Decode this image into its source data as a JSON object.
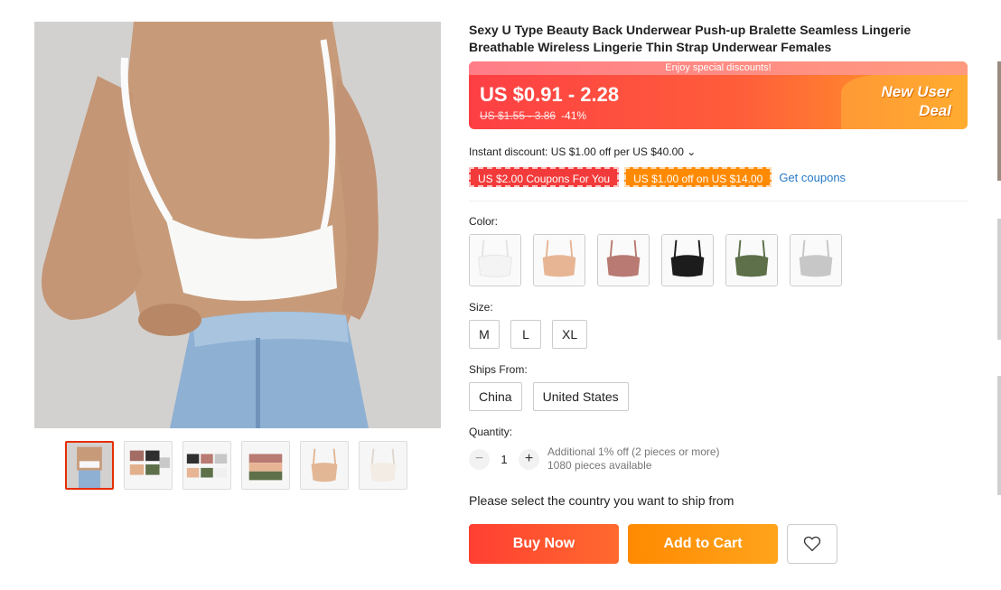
{
  "product": {
    "title": "Sexy U Type Beauty Back Underwear Push-up Bralette Seamless Lingerie Breathable Wireless Lingerie Thin Strap Underwear Females",
    "main_image_alt": "product-photo-back-view"
  },
  "gallery": {
    "thumbnails": [
      {
        "name": "thumb-1",
        "tone": "#c9b8a8"
      },
      {
        "name": "thumb-2",
        "tone": "#8a8278"
      },
      {
        "name": "thumb-3",
        "tone": "#6d6a66"
      },
      {
        "name": "thumb-4",
        "tone": "#b9a189"
      },
      {
        "name": "thumb-5",
        "tone": "#e2b796"
      },
      {
        "name": "thumb-6",
        "tone": "#efe8e0"
      }
    ]
  },
  "price": {
    "banner": "Enjoy special discounts!",
    "current": "US $0.91 - 2.28",
    "original": "US $1.55 - 3.86",
    "discount": "-41%",
    "deal_line1": "New User",
    "deal_line2": "Deal"
  },
  "instant_discount": "Instant discount: US $1.00 off per US $40.00 ⌄",
  "coupons": {
    "coupon1": "US $2.00 Coupons For You",
    "coupon2": "US $1.00 off on US $14.00",
    "get": "Get coupons"
  },
  "color": {
    "label": "Color:",
    "swatches": [
      {
        "name": "white",
        "fill": "#f4f4f4"
      },
      {
        "name": "beige",
        "fill": "#e8b594"
      },
      {
        "name": "rose",
        "fill": "#b87a72"
      },
      {
        "name": "black",
        "fill": "#1c1c1c"
      },
      {
        "name": "green",
        "fill": "#5d7049"
      },
      {
        "name": "gray",
        "fill": "#c7c7c7"
      }
    ]
  },
  "size": {
    "label": "Size:",
    "options": [
      "M",
      "L",
      "XL"
    ]
  },
  "ships_from": {
    "label": "Ships From:",
    "options": [
      "China",
      "United States"
    ]
  },
  "quantity": {
    "label": "Quantity:",
    "minus": "−",
    "value": "1",
    "plus": "+",
    "note1": "Additional 1% off (2 pieces or more)",
    "note2": "1080 pieces available"
  },
  "ship_message": "Please select the country you want to ship from",
  "actions": {
    "buy": "Buy Now",
    "cart": "Add to Cart"
  }
}
